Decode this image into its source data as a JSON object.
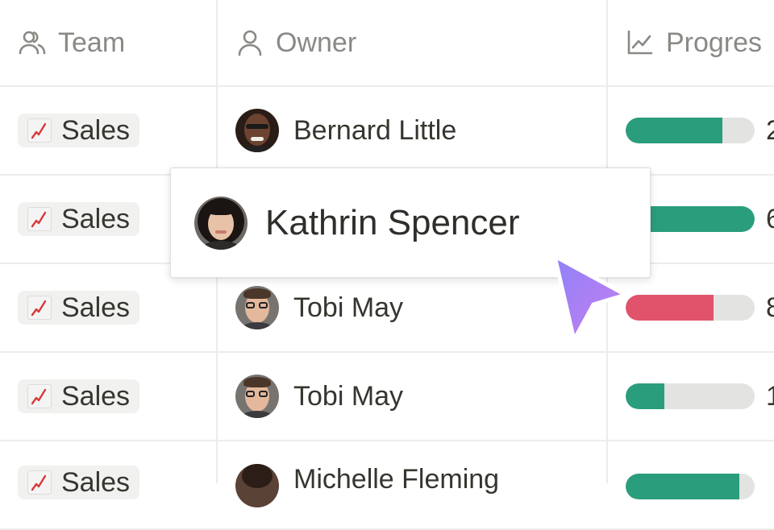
{
  "header": {
    "team_label": "Team",
    "owner_label": "Owner",
    "progress_label": "Progres"
  },
  "rows": [
    {
      "team": "Sales",
      "team_icon": "chart-increasing-emoji",
      "owner": "Bernard Little",
      "progress": 0.75,
      "progress_color": "#2a9d7c",
      "progress_text": "2"
    },
    {
      "team": "Sales",
      "team_icon": "chart-increasing-emoji",
      "owner": "",
      "progress": 1.0,
      "progress_color": "#2a9d7c",
      "progress_text": "6"
    },
    {
      "team": "Sales",
      "team_icon": "chart-increasing-emoji",
      "owner": "Tobi May",
      "progress": 0.68,
      "progress_color": "#e0536a",
      "progress_text": "8"
    },
    {
      "team": "Sales",
      "team_icon": "chart-increasing-emoji",
      "owner": "Tobi May",
      "progress": 0.3,
      "progress_color": "#2a9d7c",
      "progress_text": "1"
    },
    {
      "team": "Sales",
      "team_icon": "chart-increasing-emoji",
      "owner": "Michelle Fleming",
      "progress": 0.88,
      "progress_color": "#2a9d7c",
      "progress_text": ""
    }
  ],
  "popup": {
    "name": "Kathrin Spencer"
  },
  "colors": {
    "accent_green": "#2a9d7c",
    "accent_red": "#e0536a",
    "cursor": "#a07cf5"
  }
}
